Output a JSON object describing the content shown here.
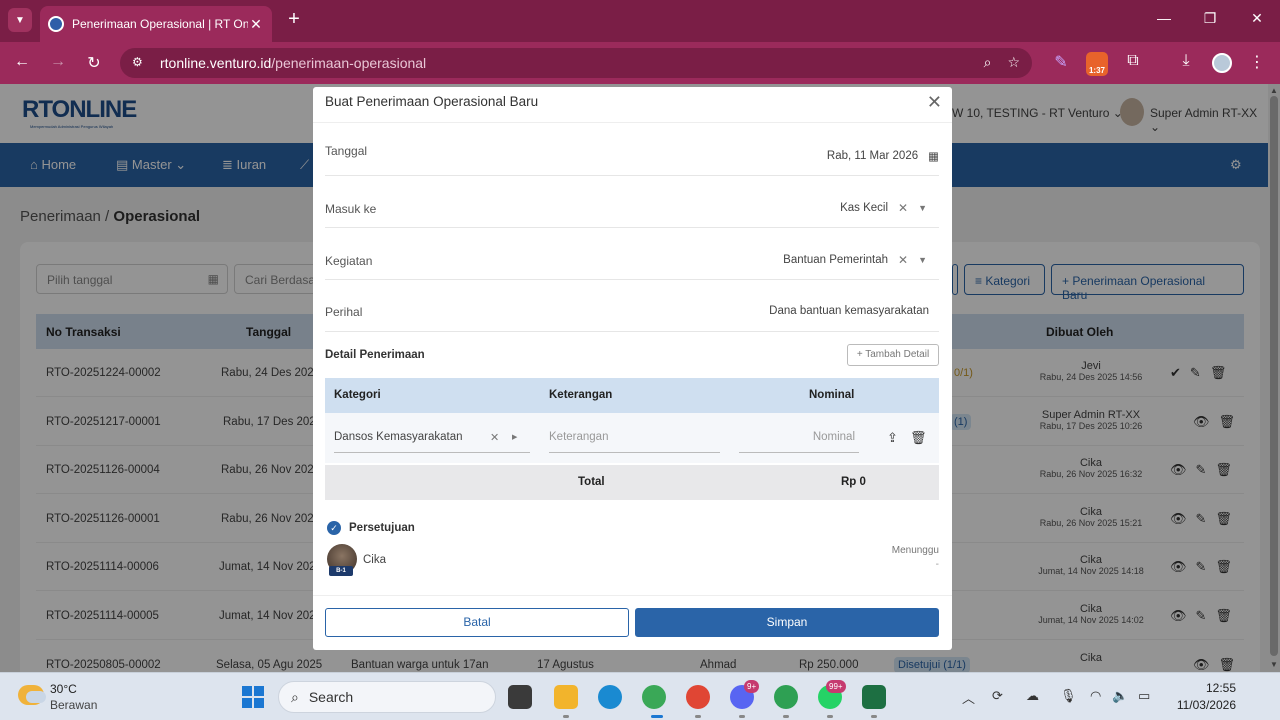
{
  "browser": {
    "tab_title": "Penerimaan Operasional | RT Online",
    "url_host": "rtonline.venturo.id",
    "url_path": "/penerimaan-operasional",
    "ext_badge": "1:37"
  },
  "app": {
    "logo": "RTONLINE",
    "logo_sub": "Mempermudah Administrasi Pengurus Wilayah",
    "location": "W 10, TESTING - RT Venturo",
    "user": "Super Admin RT-XX",
    "nav": [
      "Home",
      "Master",
      "Iuran"
    ],
    "breadcrumb_parent": "Penerimaan",
    "breadcrumb_current": "Operasional",
    "filter_date_placeholder": "Pilih tanggal",
    "filter_search_placeholder": "Cari Berdasarkan",
    "btn_kategori": "Kategori",
    "btn_new": "+ Penerimaan Operasional Baru",
    "table_headers": [
      "No Transaksi",
      "Tanggal",
      "Dibuat Oleh"
    ],
    "rows": [
      {
        "no": "RTO-20251224-00002",
        "date": "Rabu, 24 Des 2025",
        "status": "0/1)",
        "creator": "Jevi",
        "created": "Rabu, 24 Des 2025 14:56"
      },
      {
        "no": "RTO-20251217-00001",
        "date": "Rabu, 17 Des 2025",
        "status": "(1)",
        "creator": "Super Admin RT-XX",
        "created": "Rabu, 17 Des 2025 10:26"
      },
      {
        "no": "RTO-20251126-00004",
        "date": "Rabu, 26 Nov 2025",
        "status": "",
        "creator": "Cika",
        "created": "Rabu, 26 Nov 2025 16:32"
      },
      {
        "no": "RTO-20251126-00001",
        "date": "Rabu, 26 Nov 2025",
        "status": "",
        "creator": "Cika",
        "created": "Rabu, 26 Nov 2025 15:21"
      },
      {
        "no": "RTO-20251114-00006",
        "date": "Jumat, 14 Nov 2025",
        "status": "",
        "creator": "Cika",
        "created": "Jumat, 14 Nov 2025 14:18"
      },
      {
        "no": "RTO-20251114-00005",
        "date": "Jumat, 14 Nov 2025",
        "status": "",
        "creator": "Cika",
        "created": "Jumat, 14 Nov 2025 14:02"
      },
      {
        "no": "RTO-20250805-00002",
        "date": "Selasa, 05 Agu 2025",
        "desc": "Bantuan warga untuk 17an",
        "ket": "17 Agustus",
        "who": "Ahmad",
        "amount": "Rp 250.000",
        "status": "Disetujui (1/1)",
        "creator": "Cika",
        "created": ""
      }
    ]
  },
  "modal": {
    "title": "Buat Penerimaan Operasional Baru",
    "fields": [
      {
        "label": "Tanggal",
        "value": "Rab, 11 Mar 2026"
      },
      {
        "label": "Masuk ke",
        "value": "Kas Kecil"
      },
      {
        "label": "Kegiatan",
        "value": "Bantuan Pemerintah"
      },
      {
        "label": "Perihal",
        "value": "Dana bantuan kemasyarakatan"
      }
    ],
    "detail_title": "Detail Penerimaan",
    "add_detail": "+ Tambah Detail",
    "detail_headers": [
      "Kategori",
      "Keterangan",
      "Nominal"
    ],
    "detail_row": {
      "kategori": "Dansos Kemasyarakatan",
      "keterangan_placeholder": "Keterangan",
      "nominal_placeholder": "Nominal"
    },
    "total_label": "Total",
    "total_value": "Rp 0",
    "approval_title": "Persetujuan",
    "approver": {
      "name": "Cika",
      "tag": "B-1",
      "status": "Menunggu",
      "note": "-"
    },
    "btn_cancel": "Batal",
    "btn_save": "Simpan"
  },
  "taskbar": {
    "temp": "30°C",
    "weather": "Berawan",
    "search": "Search",
    "badge_discord": "9+",
    "badge_whatsapp": "99+",
    "time": "12:55",
    "date": "11/03/2026"
  }
}
